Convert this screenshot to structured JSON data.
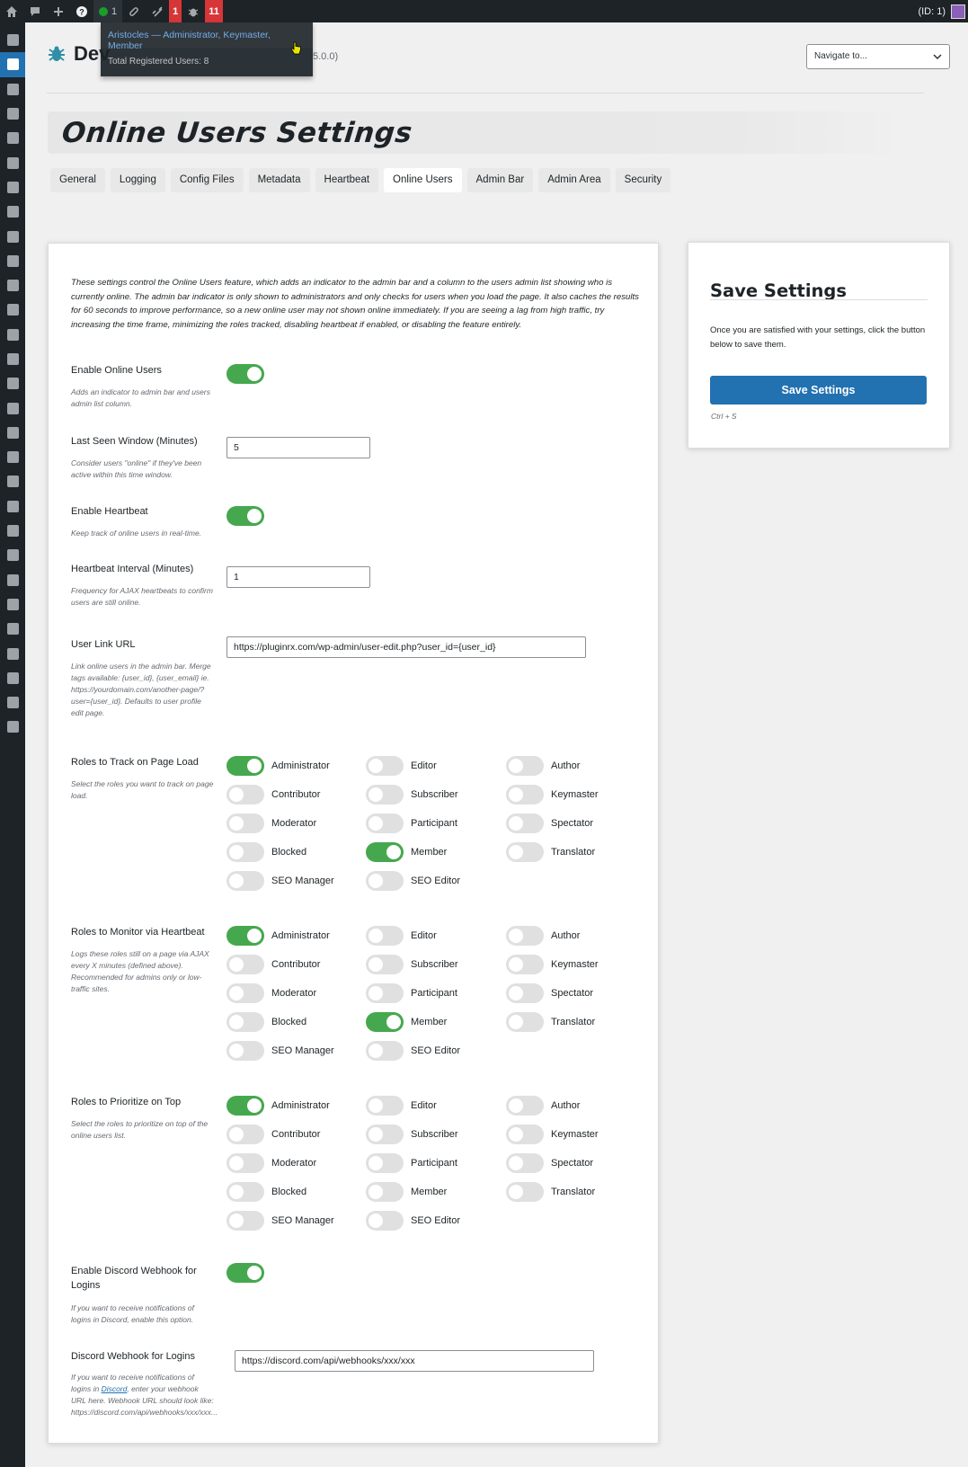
{
  "adminbar": {
    "online_count": "1",
    "badge1": "1",
    "badge2": "11",
    "user_id": "(ID: 1)"
  },
  "user_dropdown": {
    "user_roles": "Aristocles — Administrator, Keymaster, Member",
    "total": "Total Registered Users: 8"
  },
  "header": {
    "brand": "Dev",
    "version": "5.0.0)",
    "navigate_placeholder": "Navigate to..."
  },
  "page_title": "Online Users Settings",
  "tabs": [
    "General",
    "Logging",
    "Config Files",
    "Metadata",
    "Heartbeat",
    "Online Users",
    "Admin Bar",
    "Admin Area",
    "Security"
  ],
  "active_tab": "Online Users",
  "intro": "These settings control the Online Users feature, which adds an indicator to the admin bar and a column to the users admin list showing who is currently online. The admin bar indicator is only shown to administrators and only checks for users when you load the page. It also caches the results for 60 seconds to improve performance, so a new online user may not shown online immediately. If you are seeing a lag from high traffic, try increasing the time frame, minimizing the roles tracked, disabling heartbeat if enabled, or disabling the feature entirely.",
  "fields": {
    "enable_online": {
      "label": "Enable Online Users",
      "desc": "Adds an indicator to admin bar and users admin list column.",
      "on": true
    },
    "last_seen": {
      "label": "Last Seen Window (Minutes)",
      "desc": "Consider users \"online\" if they've been active within this time window.",
      "value": "5"
    },
    "enable_heartbeat": {
      "label": "Enable Heartbeat",
      "desc": "Keep track of online users in real-time.",
      "on": true
    },
    "heartbeat_interval": {
      "label": "Heartbeat Interval (Minutes)",
      "desc": "Frequency for AJAX heartbeats to confirm users are still online.",
      "value": "1"
    },
    "user_link": {
      "label": "User Link URL",
      "desc": "Link online users in the admin bar. Merge tags available: {user_id}, {user_email} ie. https://yourdomain.com/another-page/?user={user_id}. Defaults to user profile edit page.",
      "value": "https://pluginrx.com/wp-admin/user-edit.php?user_id={user_id}"
    },
    "track_roles": {
      "label": "Roles to Track on Page Load",
      "desc": "Select the roles you want to track on page load."
    },
    "heartbeat_roles": {
      "label": "Roles to Monitor via Heartbeat",
      "desc": "Logs these roles still on a page via AJAX every X minutes (defined above). Recommended for admins only or low-traffic sites."
    },
    "priority_roles": {
      "label": "Roles to Prioritize on Top",
      "desc": "Select the roles to prioritize on top of the online users list."
    },
    "discord_enable": {
      "label": "Enable Discord Webhook for Logins",
      "desc": "If you want to receive notifications of logins in Discord, enable this option.",
      "on": true
    },
    "discord_url": {
      "label": "Discord Webhook for Logins",
      "desc_before": "If you want to receive notifications of logins in ",
      "desc_link": "Discord",
      "desc_after": ", enter your webhook URL here. Webhook URL should look like: https://discord.com/api/webhooks/xxx/xxx...",
      "value": "https://discord.com/api/webhooks/xxx/xxx"
    }
  },
  "roles": [
    "Administrator",
    "Editor",
    "Author",
    "Contributor",
    "Subscriber",
    "Keymaster",
    "Moderator",
    "Participant",
    "Spectator",
    "Blocked",
    "Member",
    "Translator",
    "SEO Manager",
    "SEO Editor"
  ],
  "role_states": {
    "track": [
      true,
      false,
      false,
      false,
      false,
      false,
      false,
      false,
      false,
      false,
      true,
      false,
      false,
      false
    ],
    "heartbeat": [
      true,
      false,
      false,
      false,
      false,
      false,
      false,
      false,
      false,
      false,
      true,
      false,
      false,
      false
    ],
    "priority": [
      true,
      false,
      false,
      false,
      false,
      false,
      false,
      false,
      false,
      false,
      false,
      false,
      false,
      false
    ]
  },
  "save": {
    "title": "Save Settings",
    "desc": "Once you are satisfied with your settings, click the button below to save them.",
    "button": "Save Settings",
    "shortcut": "Ctrl + S"
  },
  "colors": {
    "toggle_on": "#46a84e",
    "primary": "#2271b1",
    "adminbar": "#1d2327"
  }
}
